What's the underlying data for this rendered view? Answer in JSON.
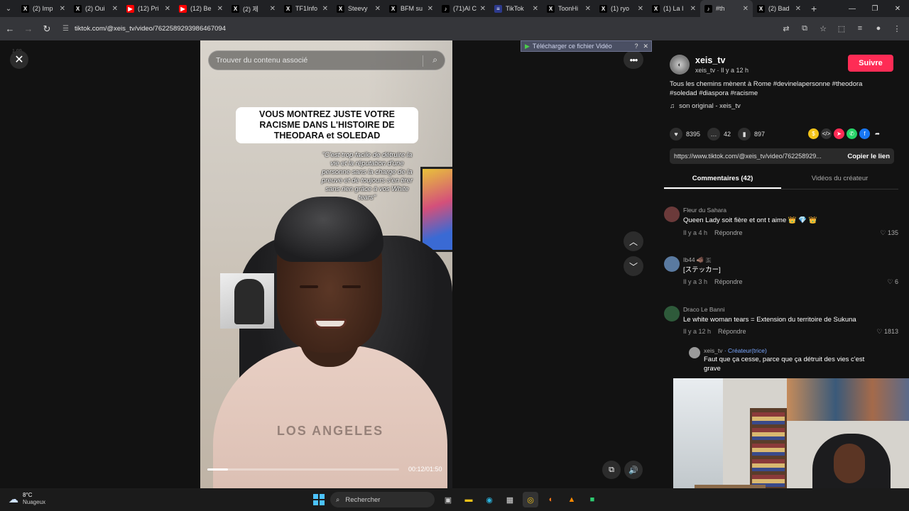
{
  "tabs": [
    {
      "label": "(2) Imp",
      "icon": "x-logo-icon",
      "active": false
    },
    {
      "label": "(2) Oui",
      "icon": "x-logo-icon",
      "active": false
    },
    {
      "label": "(12) Pri",
      "icon": "youtube-icon",
      "active": false
    },
    {
      "label": "(12) Be",
      "icon": "youtube-icon",
      "active": false
    },
    {
      "label": "(2) 제",
      "icon": "x-logo-icon",
      "active": false
    },
    {
      "label": "TF1Info",
      "icon": "x-logo-icon",
      "active": false
    },
    {
      "label": "Steevy",
      "icon": "x-logo-icon",
      "active": false
    },
    {
      "label": "BFM su",
      "icon": "x-logo-icon",
      "active": false
    },
    {
      "label": "(71)Al C",
      "icon": "tiktok-icon",
      "active": false
    },
    {
      "label": "TikTok",
      "icon": "flag-icon",
      "active": false
    },
    {
      "label": "ToonHi",
      "icon": "x-logo-icon",
      "active": false
    },
    {
      "label": "(1) ryo",
      "icon": "x-logo-icon",
      "active": false
    },
    {
      "label": "(1) La I",
      "icon": "x-logo-icon",
      "active": false
    },
    {
      "label": "#th",
      "icon": "tiktok-icon",
      "active": true
    },
    {
      "label": "(2) Bad",
      "icon": "x-logo-icon",
      "active": false
    }
  ],
  "address": {
    "url": "tiktok.com/@xeis_tv/video/7622589293986467094"
  },
  "player": {
    "zoom_hint": "1.00",
    "search_placeholder": "Trouver du contenu associé",
    "caption": "VOUS MONTREZ JUSTE VOTRE RACISME DANS L'HISTOIRE DE THEODARA et SOLEDAD",
    "quote": "\"C'est trop facile de détruire la vie et la réputation d'une personne sans la charge de la preuve et de toujours s'en tirer sans rien grâce à vos White tears\"",
    "shirt_text": "LOS ANGELES",
    "time": "00:12/01:50",
    "progress": 0.109,
    "download_label": "Télécharger ce fichier Vidéo",
    "download_help": "?"
  },
  "video_info": {
    "author_name": "xeis_tv",
    "author_sub": "xeis_tv · Il y a 12 h",
    "follow_label": "Suivre",
    "description": "Tous les chemins mènent à Rome #devinelapersonne #theodora #soledad #diaspora #racisme",
    "music": "son original - xeis_tv",
    "likes": "8395",
    "comments": "42",
    "saves": "897",
    "link": "https://www.tiktok.com/@xeis_tv/video/762258929...",
    "copy_label": "Copier le lien"
  },
  "comment_tabs": {
    "comments": "Commentaires (42)",
    "videos": "Vidéos du créateur"
  },
  "comments": [
    {
      "user": "Fleur du Sahara",
      "text": "Queen Lady soit fière et ont t aime 👑 💎 👑",
      "time": "Il y a 4 h",
      "reply": "Répondre",
      "likes": "135"
    },
    {
      "user": "Ib44 🐗 🇸",
      "text": "[ステッカー]",
      "time": "Il y a 3 h",
      "reply": "Répondre",
      "likes": "6"
    },
    {
      "user": "Draco Le Banni",
      "text": "Le white woman tears = Extension du territoire de Sukuna",
      "time": "Il y a 12 h",
      "reply": "Répondre",
      "likes": "1813"
    }
  ],
  "creator_reply": {
    "user": "xeis_tv",
    "tag": "· Créateur(trice)",
    "text": "Faut que ça cesse, parce que ça détruit des vies c'est grave"
  },
  "taskbar": {
    "temp": "8°C",
    "condition": "Nuageux",
    "search_label": "Rechercher"
  },
  "colors": {
    "follow": "#fe2c55",
    "accent_blue": "#4cc2ff"
  }
}
